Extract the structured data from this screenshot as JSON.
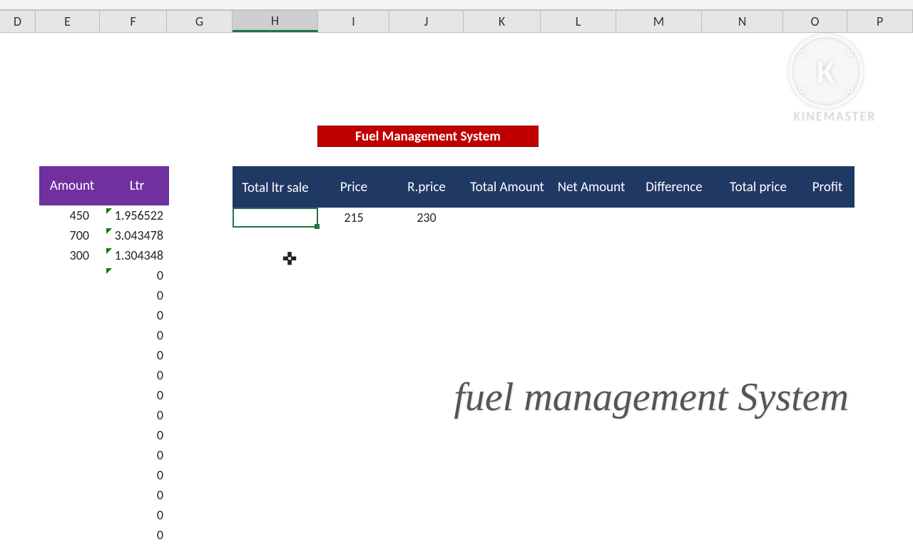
{
  "columns": [
    "D",
    "E",
    "F",
    "G",
    "H",
    "I",
    "J",
    "K",
    "L",
    "M",
    "N",
    "O",
    "P"
  ],
  "selected_column": "H",
  "banner": {
    "title": "Fuel Management System"
  },
  "left_table": {
    "headers": {
      "amount": "Amount",
      "ltr": "Ltr"
    },
    "rows": [
      {
        "amount": "450",
        "ltr": "1.956522",
        "warn": true
      },
      {
        "amount": "700",
        "ltr": "3.043478",
        "warn": true
      },
      {
        "amount": "300",
        "ltr": "1.304348",
        "warn": true
      },
      {
        "amount": "",
        "ltr": "0",
        "warn": true
      },
      {
        "amount": "",
        "ltr": "0",
        "warn": false
      },
      {
        "amount": "",
        "ltr": "0",
        "warn": false
      },
      {
        "amount": "",
        "ltr": "0",
        "warn": false
      },
      {
        "amount": "",
        "ltr": "0",
        "warn": false
      },
      {
        "amount": "",
        "ltr": "0",
        "warn": false
      },
      {
        "amount": "",
        "ltr": "0",
        "warn": false
      },
      {
        "amount": "",
        "ltr": "0",
        "warn": false
      },
      {
        "amount": "",
        "ltr": "0",
        "warn": false
      },
      {
        "amount": "",
        "ltr": "0",
        "warn": false
      },
      {
        "amount": "",
        "ltr": "0",
        "warn": false
      },
      {
        "amount": "",
        "ltr": "0",
        "warn": false
      },
      {
        "amount": "",
        "ltr": "0",
        "warn": false
      },
      {
        "amount": "",
        "ltr": "0",
        "warn": false
      }
    ]
  },
  "main_table": {
    "headers": {
      "total_ltr_sale": "Total ltr sale",
      "price": "Price",
      "r_price": "R.price",
      "total_amount": "Total Amount",
      "net_amount": "Net Amount",
      "difference": "Difference",
      "total_price": "Total price",
      "profit": "Profit"
    },
    "row": {
      "total_ltr_sale": "",
      "price": "215",
      "r_price": "230",
      "total_amount": "",
      "net_amount": "",
      "difference": "",
      "total_price": "",
      "profit": ""
    }
  },
  "watermark": {
    "logo": "K",
    "brand": "KINEMASTER"
  },
  "script_overlay": "fuel management System"
}
